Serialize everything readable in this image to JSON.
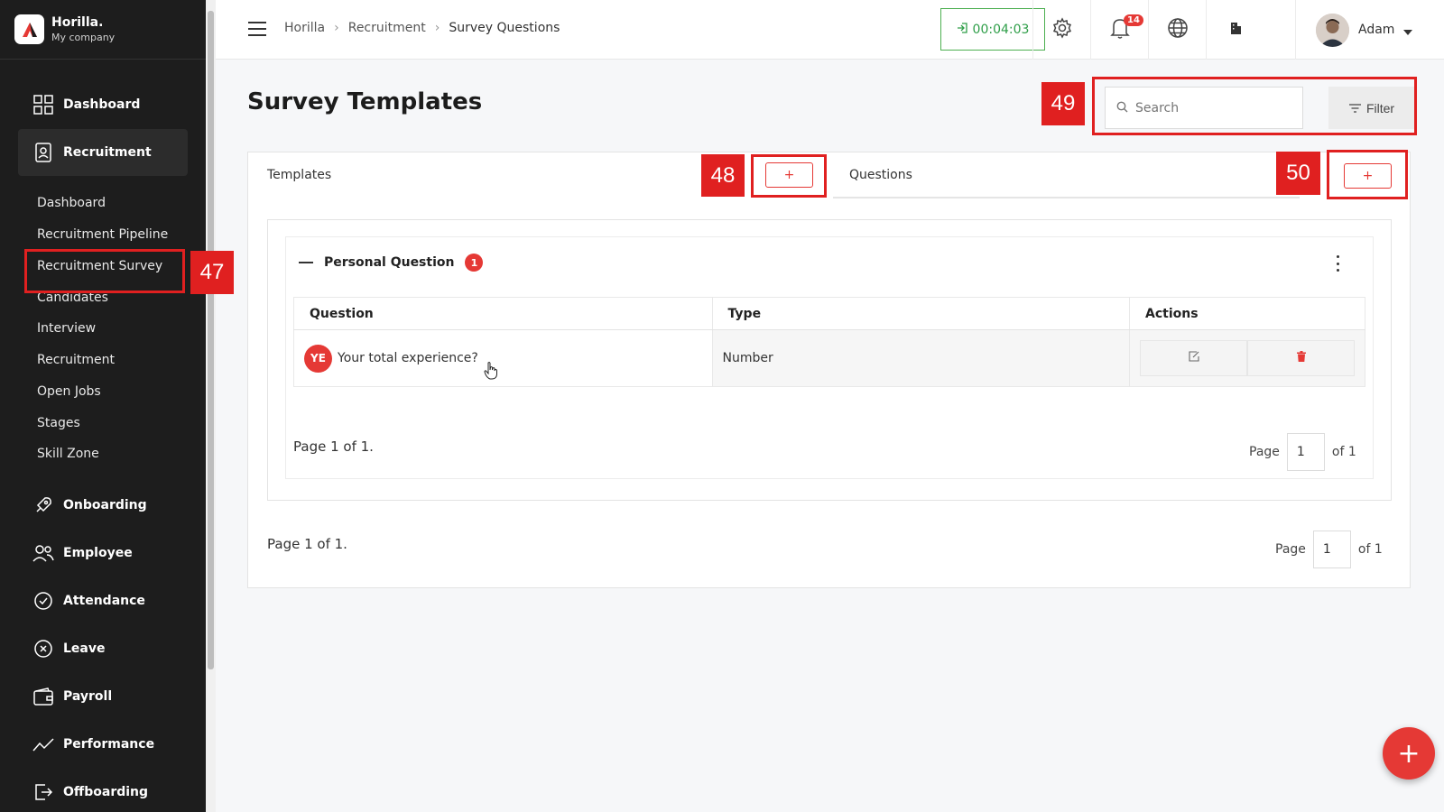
{
  "brand": {
    "name": "Horilla.",
    "company": "My company"
  },
  "sidebar": {
    "main_items": [
      {
        "label": "Dashboard",
        "icon": "dashboard-grid-icon"
      },
      {
        "label": "Recruitment",
        "icon": "recruitment-badge-icon"
      },
      {
        "label": "Onboarding",
        "icon": "rocket-icon"
      },
      {
        "label": "Employee",
        "icon": "users-icon"
      },
      {
        "label": "Attendance",
        "icon": "check-circle-icon"
      },
      {
        "label": "Leave",
        "icon": "x-circle-icon"
      },
      {
        "label": "Payroll",
        "icon": "wallet-icon"
      },
      {
        "label": "Performance",
        "icon": "trend-line-icon"
      },
      {
        "label": "Offboarding",
        "icon": "exit-icon"
      }
    ],
    "sub_items": [
      {
        "label": "Dashboard"
      },
      {
        "label": "Recruitment Pipeline"
      },
      {
        "label": "Recruitment Survey"
      },
      {
        "label": "Candidates"
      },
      {
        "label": "Interview"
      },
      {
        "label": "Recruitment"
      },
      {
        "label": "Open Jobs"
      },
      {
        "label": "Stages"
      },
      {
        "label": "Skill Zone"
      }
    ],
    "active_main": "Recruitment",
    "active_sub": "Recruitment Survey"
  },
  "topbar": {
    "breadcrumb": [
      "Horilla",
      "Recruitment",
      "Survey Questions"
    ],
    "timer": "00:04:03",
    "notification_count": "14",
    "user_name": "Adam"
  },
  "page": {
    "title": "Survey Templates",
    "search_placeholder": "Search",
    "filter_label": "Filter",
    "tab_templates": "Templates",
    "tab_questions": "Questions",
    "add_symbol": "+"
  },
  "group": {
    "name": "Personal Question",
    "count": "1",
    "columns": [
      "Question",
      "Type",
      "Actions"
    ],
    "rows": [
      {
        "avatar": "YE",
        "question": "Your total experience?",
        "type": "Number"
      }
    ],
    "pagination_text": "Page 1 of 1.",
    "page_label": "Page",
    "page_value": "1",
    "page_of": "of 1"
  },
  "outer_pagination": {
    "text": "Page 1 of 1.",
    "page_label": "Page",
    "page_value": "1",
    "page_of": "of 1"
  },
  "annotations": [
    "47",
    "48",
    "49",
    "50"
  ],
  "colors": {
    "accent": "#e53935",
    "sidebar": "#1d1d1d",
    "timer": "#2e9e48"
  }
}
